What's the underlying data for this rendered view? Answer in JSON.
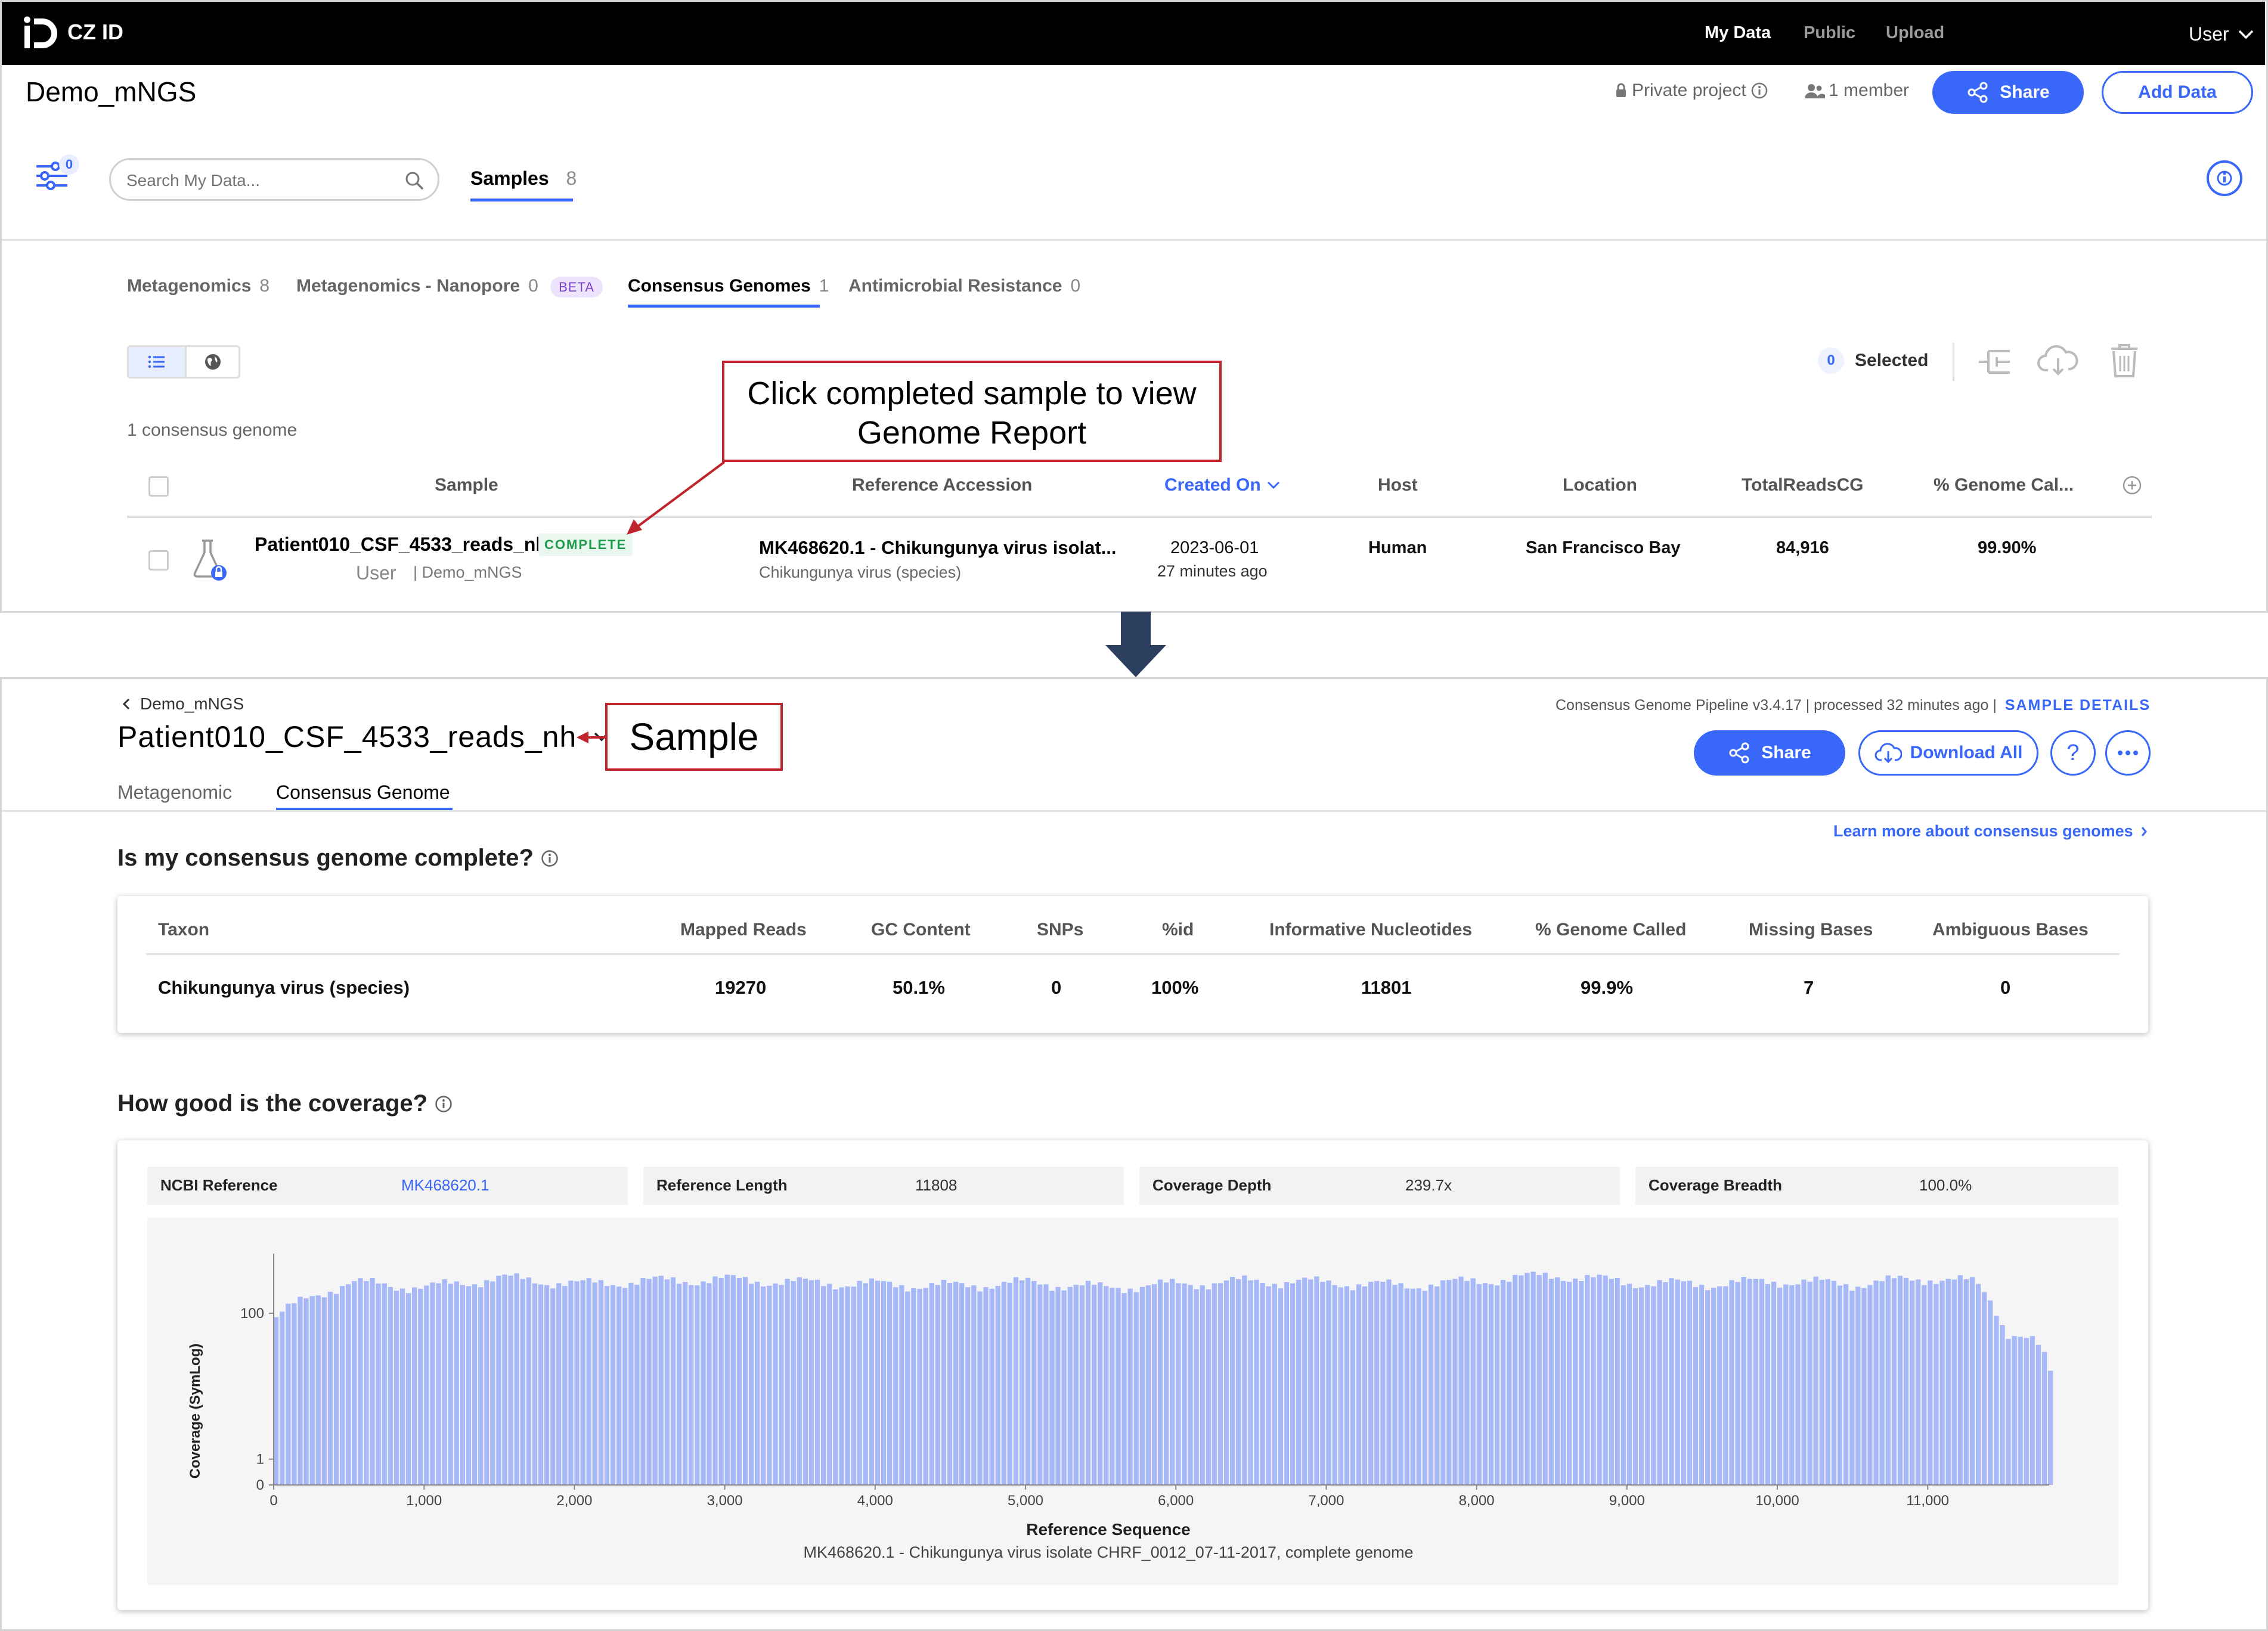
{
  "nav": {
    "logo": "CZ ID",
    "my_data": "My Data",
    "public": "Public",
    "upload": "Upload",
    "user": "User"
  },
  "project": {
    "title": "Demo_mNGS",
    "privacy": "Private project",
    "members": "1 member",
    "share": "Share",
    "add_data": "Add Data"
  },
  "filters": {
    "count": "0"
  },
  "search": {
    "placeholder": "Search My Data..."
  },
  "samples_tab": {
    "label": "Samples",
    "count": "8"
  },
  "workflow_tabs": [
    {
      "label": "Metagenomics",
      "count": "8"
    },
    {
      "label": "Metagenomics - Nanopore",
      "count": "0",
      "badge": "BETA"
    },
    {
      "label": "Consensus Genomes",
      "count": "1"
    },
    {
      "label": "Antimicrobial Resistance",
      "count": "0"
    }
  ],
  "selection": {
    "count": "0",
    "label": "Selected"
  },
  "result_count": "1 consensus genome",
  "table": {
    "headers": [
      "Sample",
      "Reference Accession",
      "Created On",
      "Host",
      "Location",
      "TotalReadsCG",
      "% Genome Cal..."
    ],
    "row": {
      "sample": "Patient010_CSF_4533_reads_nh",
      "status": "COMPLETE",
      "user": "User",
      "project": "| Demo_mNGS",
      "accession": "MK468620.1 - Chikungunya virus isolat...",
      "species": "Chikungunya virus (species)",
      "date": "2023-06-01",
      "ago": "27 minutes ago",
      "host": "Human",
      "location": "San Francisco Bay",
      "total_reads": "84,916",
      "genome_called": "99.90%"
    }
  },
  "callouts": {
    "click": "Click completed sample to view Genome Report",
    "sample": "Sample"
  },
  "report": {
    "breadcrumb": "Demo_mNGS",
    "title": "Patient010_CSF_4533_reads_nh",
    "pipeline": "Consensus Genome Pipeline v3.4.17 | processed 32 minutes ago |",
    "sample_details": "SAMPLE DETAILS",
    "share": "Share",
    "download_all": "Download All",
    "help": "?",
    "tabs": [
      "Metagenomic",
      "Consensus Genome"
    ],
    "learn_more": "Learn more about consensus genomes",
    "q1": "Is my consensus genome complete?",
    "metrics_headers": [
      "Taxon",
      "Mapped Reads",
      "GC Content",
      "SNPs",
      "%id",
      "Informative Nucleotides",
      "% Genome Called",
      "Missing Bases",
      "Ambiguous Bases"
    ],
    "metrics_values": [
      "Chikungunya virus (species)",
      "19270",
      "50.1%",
      "0",
      "100%",
      "11801",
      "99.9%",
      "7",
      "0"
    ],
    "q2": "How good is the coverage?",
    "stats": [
      {
        "label": "NCBI Reference",
        "value": "MK468620.1"
      },
      {
        "label": "Reference Length",
        "value": "11808"
      },
      {
        "label": "Coverage Depth",
        "value": "239.7x"
      },
      {
        "label": "Coverage Breadth",
        "value": "100.0%"
      }
    ]
  },
  "chart_data": {
    "type": "bar",
    "title": "",
    "xlabel": "Reference Sequence",
    "subtitle": "MK468620.1 - Chikungunya virus isolate CHRF_0012_07-11-2017, complete genome",
    "ylabel": "Coverage (SymLog)",
    "y_scale": "symlog",
    "x_range": [
      0,
      11808
    ],
    "x_ticks": [
      "0",
      "1,000",
      "2,000",
      "3,000",
      "4,000",
      "5,000",
      "6,000",
      "7,000",
      "8,000",
      "9,000",
      "10,000",
      "11,000"
    ],
    "y_ticks": [
      "0",
      "1",
      "100"
    ],
    "bar_color": "#a6b8f7",
    "x": [
      0,
      500,
      1000,
      1500,
      2000,
      2500,
      3000,
      3500,
      4000,
      4500,
      5000,
      5500,
      6000,
      6500,
      7000,
      7500,
      8000,
      8500,
      9000,
      9500,
      10000,
      10500,
      11000,
      11300,
      11500,
      11700,
      11808
    ],
    "values": [
      90,
      230,
      200,
      260,
      220,
      240,
      250,
      230,
      220,
      210,
      230,
      200,
      220,
      240,
      230,
      210,
      240,
      280,
      230,
      220,
      240,
      220,
      260,
      230,
      60,
      45,
      18
    ]
  }
}
